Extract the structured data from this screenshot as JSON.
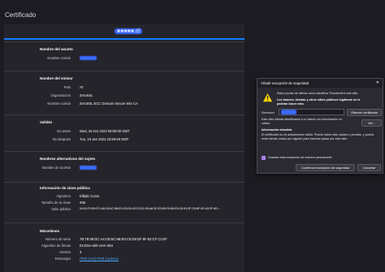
{
  "page": {
    "title": "Certificado"
  },
  "tab": {
    "label": "●●●●●.cl"
  },
  "subject": {
    "title": "Nombre del asunto",
    "rows": [
      {
        "k": "Nombre común",
        "v": "●●●●●.cl"
      }
    ]
  },
  "issuer": {
    "title": "Nombre del emisor",
    "rows": [
      {
        "k": "País",
        "v": "AT"
      },
      {
        "k": "Organización",
        "v": "ZeroSSL"
      },
      {
        "k": "Nombre común",
        "v": "ZeroSSL ECC Domain Secure Site CA"
      }
    ]
  },
  "validity": {
    "title": "Validez",
    "rows": [
      {
        "k": "No antes",
        "v": "Wed, 25 Oct 2023 00:00:00 GMT"
      },
      {
        "k": "No después",
        "v": "Tue, 23 Jan 2024 23:59:59 GMT"
      }
    ]
  },
  "san": {
    "title": "Nombres alternativos del sujeto",
    "rows": [
      {
        "k": "Nombre de la DNS",
        "v": "●●●●●.cl"
      }
    ]
  },
  "pubkey": {
    "title": "Información de clave pública",
    "rows": [
      {
        "k": "Algoritmo",
        "v": "Elliptic Curve"
      },
      {
        "k": "Tamaño de la clave",
        "v": "256"
      },
      {
        "k": "Valor público",
        "v": "04:61:F2:B9:FC:A6:C8:5C:9B:E0:C5:D9:43:C3:E1:09:A6:2E:E3:80:F6:88:E5:C8:93:3F:C5:6F:0E:A3:2F:6D:..."
      }
    ]
  },
  "misc": {
    "title": "Misceláneo",
    "rows": [
      {
        "k": "Número de serie",
        "v": "7B:7B:06:DC:A4:CB:5C:9B:E0:C5:D9:DF:9F:62:CF:C3:0F"
      },
      {
        "k": "Algoritmo de firmas",
        "v": "ECDSA with SHA-384"
      },
      {
        "k": "Versión",
        "v": "3"
      }
    ],
    "download_label": "Descargar",
    "download_links": "PEM (cert) PEM (cadena)"
  },
  "dialog": {
    "title": "Añadir excepción de seguridad",
    "close": "✕",
    "intro": "Está a punto de alterar cómo identifica Thunderbird este sitio.",
    "warning": "Los bancos, tiendas y otros sitios públicos legítimos no le pedirán hacer esto.",
    "server_label": "Dirección:",
    "server_value": "●●●●●.cl",
    "get_cert_button": "Obtener certificado",
    "status_text": "Este sitio intenta identificarse a sí mismo con información no válida.",
    "view_button": "Ver...",
    "status_title": "Información obsoleta",
    "status_detail": "El certificado no es actualmente válido. Puede haber sido robado o perdido, y podría estar siendo usado por alguien para hacerse pasar por este sitio.",
    "checkbox_label": "Guardar esta excepción de manera permanente",
    "confirm_button": "Confirmar excepción de seguridad",
    "cancel_button": "Cancelar"
  }
}
